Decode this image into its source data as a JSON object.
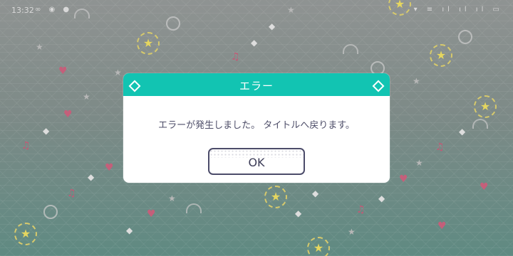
{
  "status_bar": {
    "time": "13:32",
    "left_icons": "∞ ◉ ●",
    "right_icons": "▾ ≡ ıl ıl ıl ▭"
  },
  "dialog": {
    "title": "エラー",
    "message": "エラーが発生しました。 タイトルへ戻ります。",
    "ok_label": "OK"
  },
  "colors": {
    "header": "#12c4b2",
    "button_border": "#4c4c6a",
    "text": "#4d4d68"
  }
}
